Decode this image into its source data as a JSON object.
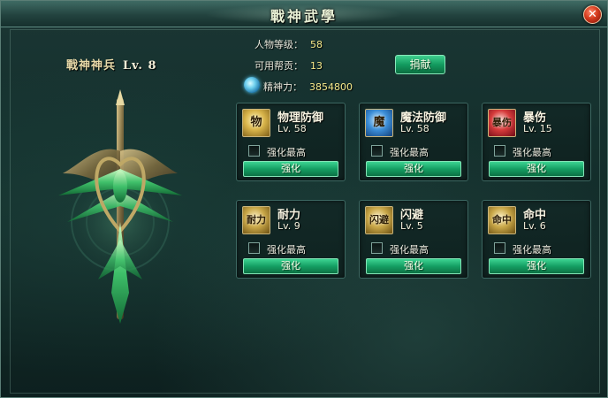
{
  "window": {
    "title": "戰神武學",
    "close_symbol": "✕"
  },
  "weapon": {
    "name": "戰神神兵",
    "level": "Lv. 8"
  },
  "stats": {
    "level_label": "人物等级：",
    "level_value": "58",
    "contribution_label": "可用帮贡：",
    "contribution_value": "13",
    "spirit_label": "精神力：",
    "spirit_value": "3854800"
  },
  "donate_button": "捐献",
  "skills": [
    {
      "name": "物理防御",
      "level": "Lv. 58",
      "icon_glyph": "物",
      "icon": "physical-defense-icon",
      "checkbox_label": "强化最高",
      "button": "强化"
    },
    {
      "name": "魔法防御",
      "level": "Lv. 58",
      "icon_glyph": "魔",
      "icon": "magic-defense-icon",
      "checkbox_label": "强化最高",
      "button": "强化"
    },
    {
      "name": "暴伤",
      "level": "Lv. 15",
      "icon_glyph": "暴伤",
      "icon": "crit-damage-icon",
      "checkbox_label": "强化最高",
      "button": "强化"
    },
    {
      "name": "耐力",
      "level": "Lv. 9",
      "icon_glyph": "耐力",
      "icon": "endurance-icon",
      "checkbox_label": "强化最高",
      "button": "强化"
    },
    {
      "name": "闪避",
      "level": "Lv. 5",
      "icon_glyph": "闪避",
      "icon": "dodge-icon",
      "checkbox_label": "强化最高",
      "button": "强化"
    },
    {
      "name": "命中",
      "level": "Lv. 6",
      "icon_glyph": "命中",
      "icon": "accuracy-icon",
      "checkbox_label": "强化最高",
      "button": "强化"
    }
  ],
  "colors": {
    "accent_green": "#159f63",
    "value_yellow": "#f5e88a",
    "title_text": "#e9f1d6"
  }
}
